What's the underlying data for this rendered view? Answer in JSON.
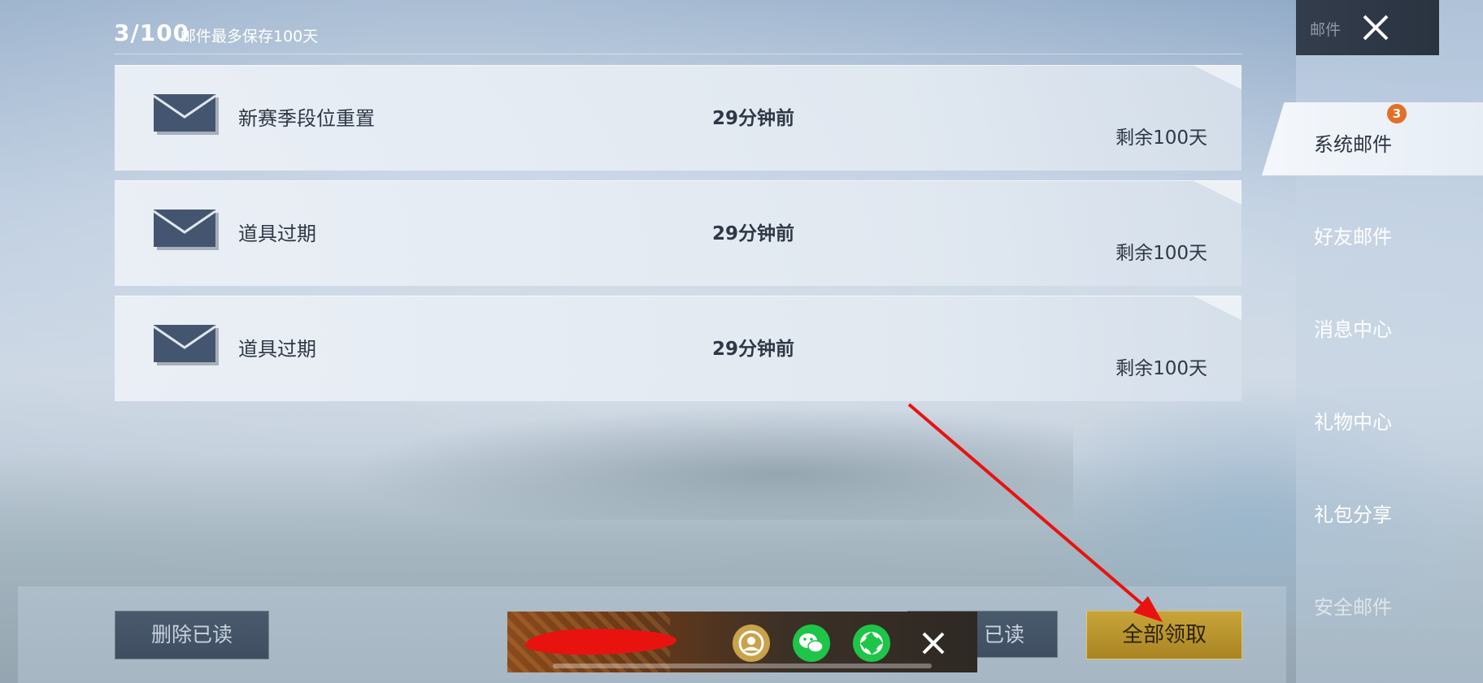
{
  "header": {
    "counter": "3/100",
    "retention_note": "邮件最多保存100天"
  },
  "mails": [
    {
      "title": "新赛季段位重置",
      "time": "29分钟前",
      "remaining": "剩余100天",
      "icon": "envelope-icon"
    },
    {
      "title": "道具过期",
      "time": "29分钟前",
      "remaining": "剩余100天",
      "icon": "envelope-icon"
    },
    {
      "title": "道具过期",
      "time": "29分钟前",
      "remaining": "剩余100天",
      "icon": "envelope-icon"
    }
  ],
  "sidebar": {
    "title": "邮件",
    "close_icon": "close-icon",
    "items": [
      {
        "label": "系统邮件",
        "active": true,
        "badge": "3"
      },
      {
        "label": "好友邮件"
      },
      {
        "label": "消息中心"
      },
      {
        "label": "礼物中心"
      },
      {
        "label": "礼包分享"
      },
      {
        "label": "安全邮件",
        "disabled": true
      }
    ]
  },
  "actions": {
    "delete_read": "删除已读",
    "mark_read_visible": "已读",
    "claim_all": "全部领取"
  },
  "share_overlay": {
    "icons": [
      "qq-zone-icon",
      "wechat-icon",
      "wechat-moments-icon"
    ],
    "close_icon": "close-icon"
  },
  "colors": {
    "badge": "#e27026",
    "claim_button": "#c8a53a",
    "annotation_arrow": "#e8130f",
    "redaction": "#e8130f"
  }
}
